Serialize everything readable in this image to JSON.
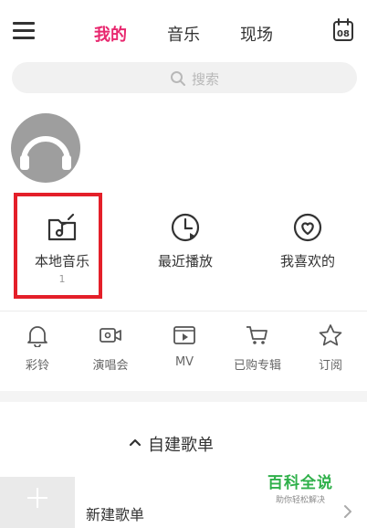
{
  "top_nav": {
    "tabs": [
      {
        "label": "我的",
        "active": true
      },
      {
        "label": "音乐",
        "active": false
      },
      {
        "label": "现场",
        "active": false
      }
    ],
    "calendar_day": "08"
  },
  "search": {
    "placeholder": "搜索"
  },
  "quick_actions": [
    {
      "label": "本地音乐",
      "count": "1",
      "icon": "local-music-icon"
    },
    {
      "label": "最近播放",
      "icon": "recent-play-icon"
    },
    {
      "label": "我喜欢的",
      "icon": "favorite-icon"
    }
  ],
  "features": [
    {
      "label": "彩铃",
      "icon": "bell-icon"
    },
    {
      "label": "演唱会",
      "icon": "concert-video-icon"
    },
    {
      "label": "MV",
      "icon": "mv-icon"
    },
    {
      "label": "已购专辑",
      "icon": "cart-icon"
    },
    {
      "label": "订阅",
      "icon": "star-icon"
    }
  ],
  "playlists": {
    "section_title": "自建歌单",
    "new_playlist_label": "新建歌单"
  },
  "watermark": {
    "brand": "百科全说",
    "slogan": "助你轻松解决"
  },
  "colors": {
    "accent": "#e8276e",
    "highlight_box": "#e41f29",
    "watermark": "#2fb04a"
  }
}
